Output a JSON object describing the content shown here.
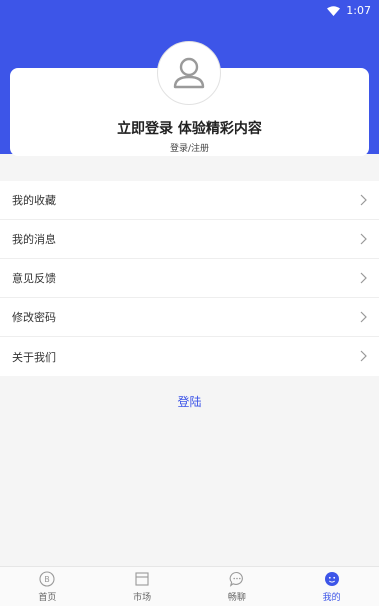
{
  "status_bar": {
    "time": "1:07"
  },
  "profile": {
    "title": "立即登录 体验精彩内容",
    "subtitle": "登录/注册"
  },
  "menu": {
    "items": [
      {
        "label": "我的收藏"
      },
      {
        "label": "我的消息"
      },
      {
        "label": "意见反馈"
      },
      {
        "label": "修改密码"
      },
      {
        "label": "关于我们"
      }
    ]
  },
  "login_button": "登陆",
  "tabbar": {
    "items": [
      {
        "label": "首页",
        "icon": "coin-icon"
      },
      {
        "label": "市场",
        "icon": "box-icon"
      },
      {
        "label": "畅聊",
        "icon": "chat-icon"
      },
      {
        "label": "我的",
        "icon": "face-icon",
        "active": true
      }
    ]
  },
  "colors": {
    "accent": "#3d55e8"
  }
}
